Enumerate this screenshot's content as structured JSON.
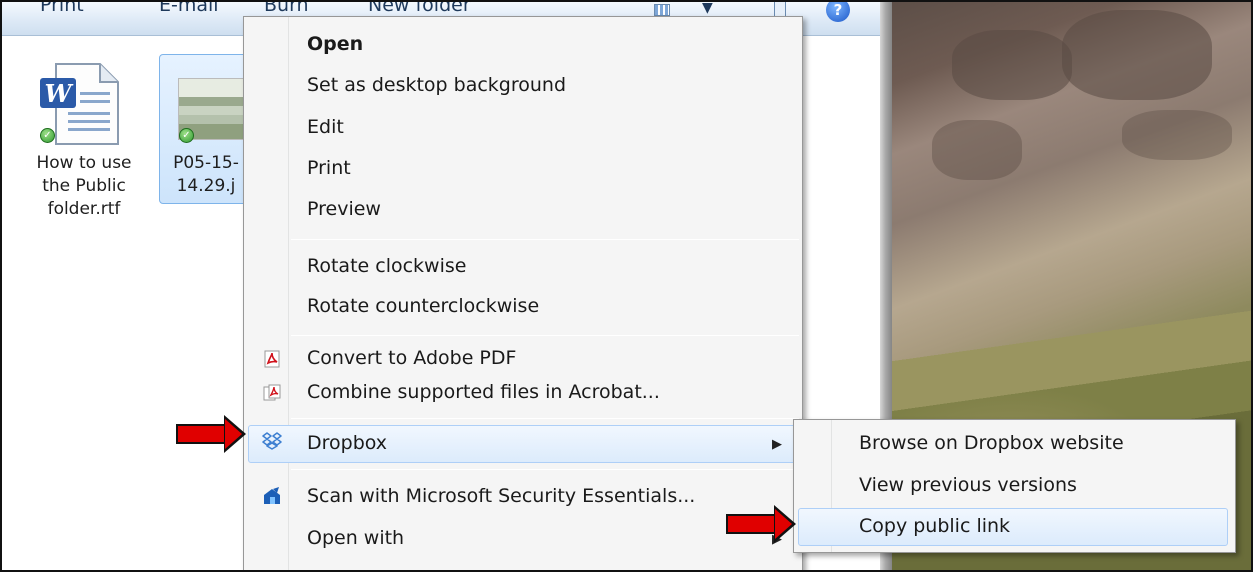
{
  "toolbar": {
    "items": [
      "Print",
      "E-mail",
      "Burn",
      "New folder"
    ]
  },
  "files": [
    {
      "name_lines": [
        "How to use",
        "the Public",
        "folder.rtf"
      ],
      "selected": false
    },
    {
      "name_lines": [
        "P05-15-",
        "14.29.j"
      ],
      "selected": true
    }
  ],
  "context_menu": {
    "items": [
      {
        "label": "Open",
        "bold": true
      },
      {
        "label": "Set as desktop background"
      },
      {
        "label": "Edit"
      },
      {
        "label": "Print"
      },
      {
        "label": "Preview"
      },
      {
        "label": "Rotate clockwise"
      },
      {
        "label": "Rotate counterclockwise"
      },
      {
        "label": "Convert to Adobe PDF",
        "icon": "adobe-pdf-icon"
      },
      {
        "label": "Combine supported files in Acrobat...",
        "icon": "acrobat-combine-icon"
      },
      {
        "label": "Dropbox",
        "icon": "dropbox-icon",
        "has_submenu": true,
        "highlighted": true
      },
      {
        "label": "Scan with Microsoft Security Essentials...",
        "icon": "security-essentials-icon"
      },
      {
        "label": "Open with",
        "has_submenu": true
      }
    ]
  },
  "dropbox_submenu": {
    "items": [
      {
        "label": "Browse on Dropbox website"
      },
      {
        "label": "View previous versions"
      },
      {
        "label": "Copy public link",
        "highlighted": true
      }
    ]
  },
  "colors": {
    "highlight_border": "#aecff7",
    "annotation_arrow": "#e00000"
  }
}
